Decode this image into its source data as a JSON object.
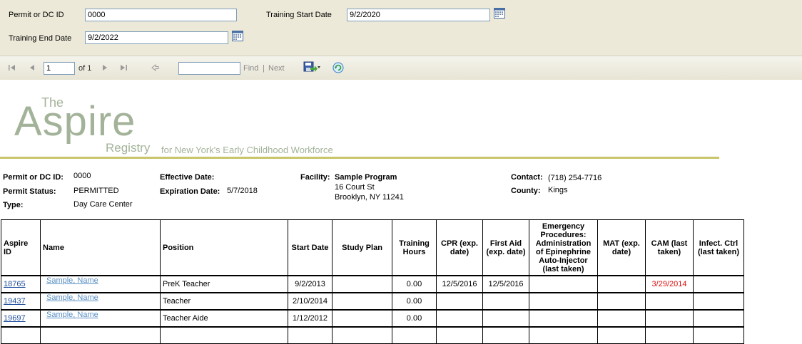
{
  "params": {
    "permit_label": "Permit or DC ID",
    "permit_value": "0000",
    "start_label": "Training Start Date",
    "start_value": "9/2/2020",
    "end_label": "Training End Date",
    "end_value": "9/2/2022",
    "calendar_icon": "calendar-icon"
  },
  "toolbar": {
    "page_value": "1",
    "of_label": "of 1",
    "find_label": "Find",
    "sep": "|",
    "next_label": "Next",
    "find_value": ""
  },
  "logo": {
    "the": "The",
    "aspire": "Aspire",
    "registry": "Registry",
    "tagline": "for New York's Early Childhood Workforce"
  },
  "info": {
    "permit_label": "Permit or DC ID:",
    "permit_value": "0000",
    "status_label": "Permit Status:",
    "status_value": "PERMITTED",
    "type_label": "Type:",
    "type_value": "Day Care Center",
    "effective_label": "Effective Date:",
    "expiration_label": "Expiration Date:",
    "expiration_value": "5/7/2018",
    "facility_label": "Facility:",
    "facility_name": "Sample Program",
    "facility_addr1": "16 Court St",
    "facility_addr2": "Brooklyn, NY 11241",
    "contact_label": "Contact:",
    "contact_value": "(718) 254-7716",
    "county_label": "County:",
    "county_value": "Kings"
  },
  "table": {
    "headers": [
      "Aspire ID",
      "Name",
      "Position",
      "Start Date",
      "Study Plan",
      "Training Hours",
      "CPR (exp. date)",
      "First Aid (exp. date)",
      "Emergency Procedures: Administration of Epinephrine Auto-Injector (last taken)",
      "MAT (exp. date)",
      "CAM (last taken)",
      "Infect. Ctrl (last taken)"
    ],
    "rows": [
      {
        "id": "18765",
        "name": "Sample, Name",
        "position": "PreK Teacher",
        "start": "9/2/2013",
        "plan": "",
        "hours": "0.00",
        "cpr": "12/5/2016",
        "first_aid": "12/5/2016",
        "epi": "",
        "mat": "",
        "cam": "3/29/2014",
        "infect": ""
      },
      {
        "id": "19437",
        "name": "Sample, Name",
        "position": "Teacher",
        "start": "2/10/2014",
        "plan": "",
        "hours": "0.00",
        "cpr": "",
        "first_aid": "",
        "epi": "",
        "mat": "",
        "cam": "",
        "infect": ""
      },
      {
        "id": "19697",
        "name": "Sample, Name",
        "position": "Teacher Aide",
        "start": "1/12/2012",
        "plan": "",
        "hours": "0.00",
        "cpr": "",
        "first_aid": "",
        "epi": "",
        "mat": "",
        "cam": "",
        "infect": ""
      }
    ]
  }
}
